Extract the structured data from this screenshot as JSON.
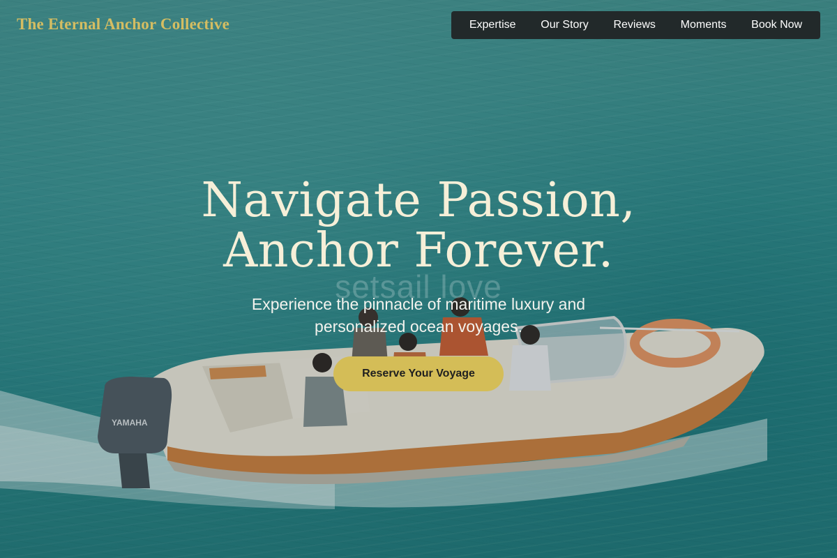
{
  "brand": {
    "name": "The Eternal Anchor Collective"
  },
  "nav": {
    "items": [
      {
        "label": "Expertise"
      },
      {
        "label": "Our Story"
      },
      {
        "label": "Reviews"
      },
      {
        "label": "Moments"
      },
      {
        "label": "Book Now"
      }
    ]
  },
  "hero": {
    "headline_line1": "Navigate Passion,",
    "headline_line2": "Anchor Forever.",
    "watermark": "setsail love",
    "subtitle": "Experience the pinnacle of maritime luxury and personalized ocean voyages.",
    "cta_label": "Reserve Your Voyage",
    "boat_brand": "YAMAHA"
  },
  "colors": {
    "accent_gold": "#d4bd57",
    "brand_gold": "#d4bd62",
    "nav_bg": "#22292a",
    "headline": "#f6efd8",
    "sea": "#2f8b8c"
  }
}
